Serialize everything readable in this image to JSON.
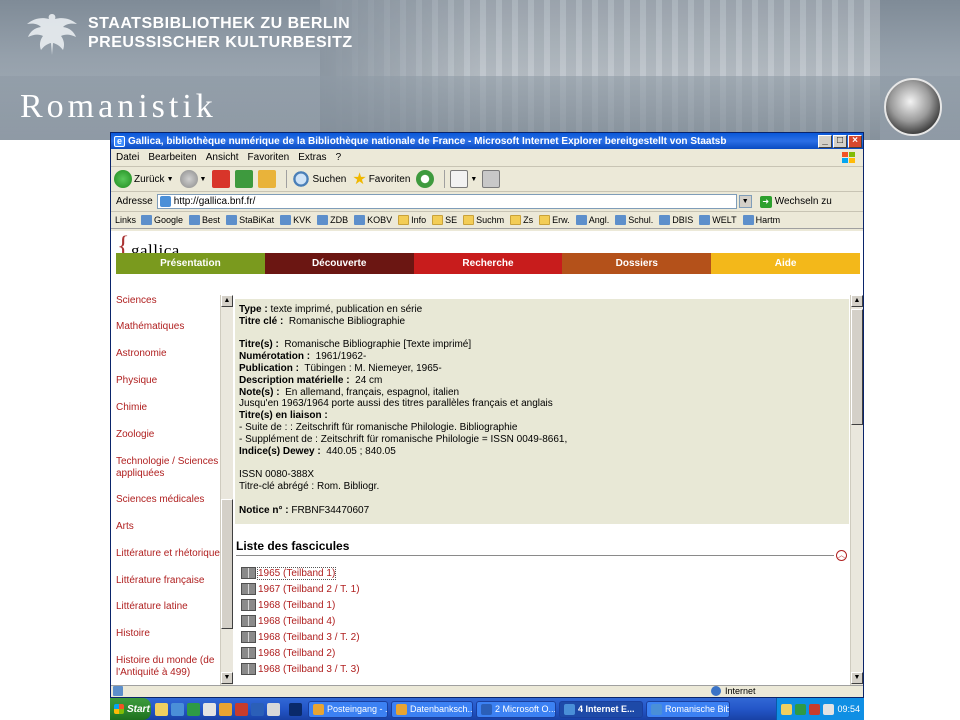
{
  "slide": {
    "library_line1": "STAATSBIBLIOTHEK ZU BERLIN",
    "library_line2": "PREUSSISCHER KULTURBESITZ",
    "title": "Romanistik"
  },
  "window": {
    "title": "Gallica, bibliothèque numérique de la Bibliothèque nationale de France - Microsoft Internet Explorer bereitgestellt von Staatsb",
    "minimize": "_",
    "maximize": "□",
    "close": "×"
  },
  "menu": [
    "Datei",
    "Bearbeiten",
    "Ansicht",
    "Favoriten",
    "Extras",
    "?"
  ],
  "toolbar": {
    "back": "Zurück",
    "search": "Suchen",
    "favorites": "Favoriten"
  },
  "address": {
    "label": "Adresse",
    "url": "http://gallica.bnf.fr/",
    "go": "Wechseln zu"
  },
  "links": {
    "label": "Links",
    "items": [
      {
        "label": "Google",
        "icon": "page"
      },
      {
        "label": "Best",
        "icon": "page"
      },
      {
        "label": "StaBiKat",
        "icon": "page"
      },
      {
        "label": "KVK",
        "icon": "page"
      },
      {
        "label": "ZDB",
        "icon": "page"
      },
      {
        "label": "KOBV",
        "icon": "page"
      },
      {
        "label": "Info",
        "icon": "folder"
      },
      {
        "label": "SE",
        "icon": "folder"
      },
      {
        "label": "Suchm",
        "icon": "folder"
      },
      {
        "label": "Zs",
        "icon": "folder"
      },
      {
        "label": "Erw.",
        "icon": "folder"
      },
      {
        "label": "Angl.",
        "icon": "page"
      },
      {
        "label": "Schul.",
        "icon": "page"
      },
      {
        "label": "DBIS",
        "icon": "page"
      },
      {
        "label": "WELT",
        "icon": "page"
      },
      {
        "label": "Hartm",
        "icon": "page"
      }
    ]
  },
  "gallica": {
    "logo_brace": "{",
    "logo_word": "gallica",
    "nav": [
      {
        "label": "Présentation",
        "color": "#7a9a1e"
      },
      {
        "label": "Découverte",
        "color": "#6b1612"
      },
      {
        "label": "Recherche",
        "color": "#c81c1c"
      },
      {
        "label": "Dossiers",
        "color": "#b4511a"
      },
      {
        "label": "Aide",
        "color": "#f3b81a"
      }
    ],
    "sidebar": [
      "Sciences",
      "Mathématiques",
      "Astronomie",
      "Physique",
      "Chimie",
      "Zoologie",
      "Technologie / Sciences appliquées",
      "Sciences médicales",
      "Arts",
      "Littérature et rhétorique",
      "Littérature française",
      "Littérature latine",
      "Histoire",
      "Histoire du monde (de l'Antiquité à 499)"
    ],
    "record": {
      "type_label": "Type :",
      "type_value": "texte imprimé, publication en série",
      "key_title_label": "Titre clé :",
      "key_title_value": "Romanische Bibliographie",
      "titles_label": "Titre(s) :",
      "titles_value": "Romanische Bibliographie [Texte imprimé]",
      "numbering_label": "Numérotation :",
      "numbering_value": "1961/1962-",
      "publication_label": "Publication :",
      "publication_value": "Tübingen : M. Niemeyer, 1965-",
      "description_label": "Description matérielle :",
      "description_value": "24 cm",
      "notes_label": "Note(s) :",
      "notes_value": "En allemand, français, espagnol, italien",
      "notes_line2": "Jusqu'en 1963/1964 porte aussi des titres parallèles français et anglais",
      "linked_label": "Titre(s) en liaison :",
      "linked_line1": "- Suite de : : Zeitschrift für romanische Philologie. Bibliographie",
      "linked_line2": "- Supplément de : Zeitschrift für romanische Philologie = ISSN 0049-8661,",
      "dewey_label": "Indice(s) Dewey :",
      "dewey_value": "440.05 ; 840.05",
      "issn": "ISSN 0080-388X",
      "abbr_title": "Titre-clé abrégé : Rom. Bibliogr.",
      "notice_label": "Notice n° :",
      "notice_value": "FRBNF34470607"
    },
    "fascicles_title": "Liste des fascicules",
    "fascicles": [
      "1965 (Teilband 1)",
      "1967 (Teilband 2 / T. 1)",
      "1968 (Teilband 1)",
      "1968 (Teilband 4)",
      "1968 (Teilband 3 / T. 2)",
      "1968 (Teilband 2)",
      "1968 (Teilband 3 / T. 3)"
    ]
  },
  "status": {
    "zone": "Internet"
  },
  "taskbar": {
    "start": "Start",
    "tasks": [
      {
        "label": "Posteingang - ...",
        "color": "#e8a432"
      },
      {
        "label": "Datenbanksch...",
        "color": "#e8a432"
      },
      {
        "label": "2 Microsoft O...",
        "color": "#2b5fb8"
      },
      {
        "label": "4 Internet E...",
        "color": "#4a8fd8"
      },
      {
        "label": "Romanische Bib...",
        "color": "#4a8fd8"
      }
    ],
    "clock": "09:54"
  }
}
